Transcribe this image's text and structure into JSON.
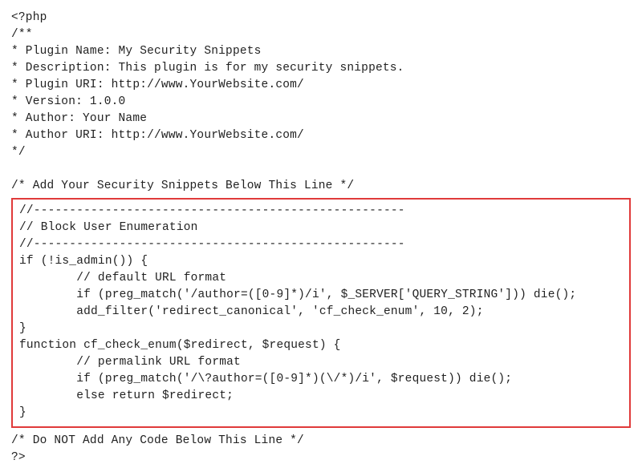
{
  "header": {
    "l1": "<?php",
    "l2": "/**",
    "l3": "* Plugin Name: My Security Snippets",
    "l4": "* Description: This plugin is for my security snippets.",
    "l5": "* Plugin URI: http://www.YourWebsite.com/",
    "l6": "* Version: 1.0.0",
    "l7": "* Author: Your Name",
    "l8": "* Author URI: http://www.YourWebsite.com/",
    "l9": "*/",
    "l10": "",
    "l11": "/* Add Your Security Snippets Below This Line */"
  },
  "box": {
    "l1": "//----------------------------------------------------",
    "l2": "// Block User Enumeration",
    "l3": "//----------------------------------------------------",
    "l4": "if (!is_admin()) {",
    "l5": "        // default URL format",
    "l6": "        if (preg_match('/author=([0-9]*)/i', $_SERVER['QUERY_STRING'])) die();",
    "l7": "        add_filter('redirect_canonical', 'cf_check_enum', 10, 2);",
    "l8": "}",
    "l9": "function cf_check_enum($redirect, $request) {",
    "l10": "        // permalink URL format",
    "l11": "        if (preg_match('/\\?author=([0-9]*)(\\/*)/i', $request)) die();",
    "l12": "        else return $redirect;",
    "l13": "}"
  },
  "footer": {
    "l1": "/* Do NOT Add Any Code Below This Line */",
    "l2": "?>"
  }
}
